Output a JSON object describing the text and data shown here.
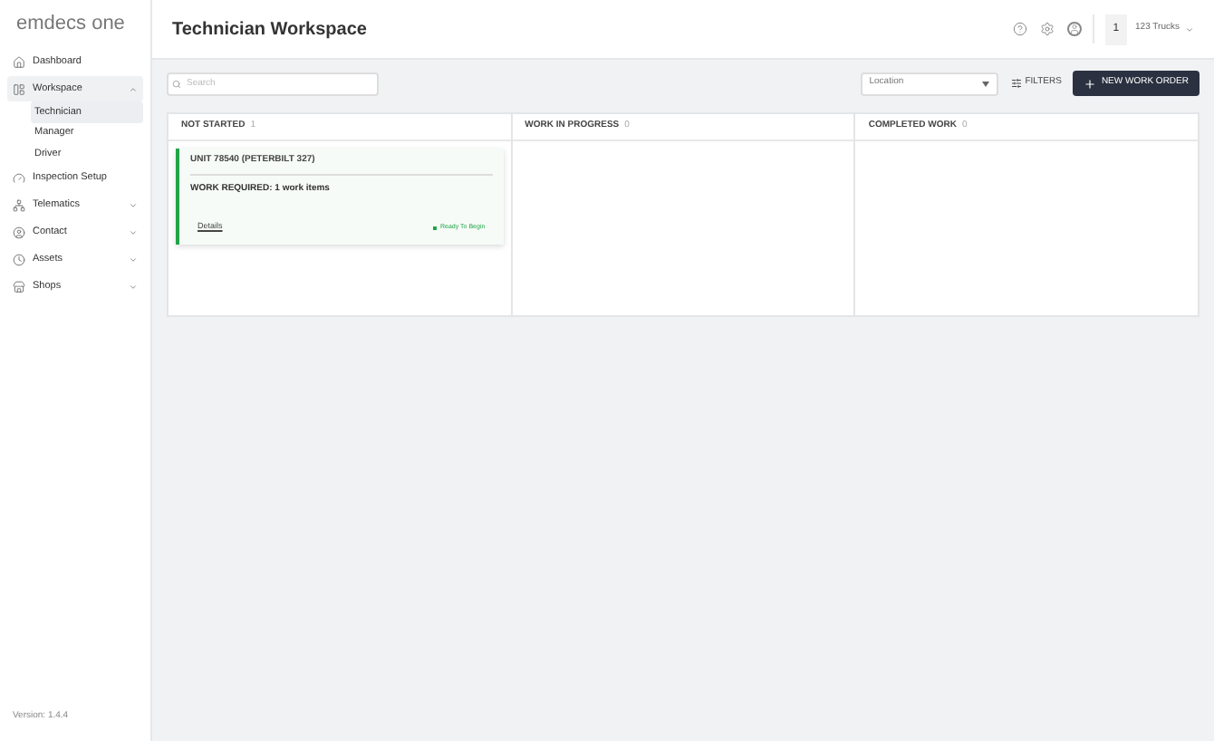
{
  "logo": "emdecs one",
  "sidebar": {
    "items": [
      {
        "label": "Dashboard",
        "kind": "link",
        "selected": false
      },
      {
        "label": "Workspace",
        "kind": "group",
        "expanded": true,
        "selected": true,
        "children": [
          {
            "label": "Technician",
            "selected": true
          },
          {
            "label": "Manager",
            "selected": false
          },
          {
            "label": "Driver",
            "selected": false
          }
        ]
      },
      {
        "label": "Inspection Setup",
        "kind": "link",
        "selected": false
      },
      {
        "label": "Telematics",
        "kind": "group",
        "expanded": false,
        "selected": false
      },
      {
        "label": "Contact",
        "kind": "group",
        "expanded": false,
        "selected": false
      },
      {
        "label": "Assets",
        "kind": "group",
        "expanded": false,
        "selected": false
      },
      {
        "label": "Shops",
        "kind": "group",
        "expanded": false,
        "selected": false
      }
    ],
    "version": "Version: 1.4.4"
  },
  "header": {
    "title": "Technician Workspace",
    "count": "1",
    "trucks": "123 Trucks"
  },
  "toolbar": {
    "search": {
      "placeholder": "Search"
    },
    "location": {
      "placeholder": "Location"
    },
    "filters": "FILTERS",
    "new_button": "NEW WORK ORDER"
  },
  "columns": [
    {
      "title": "NOT STARTED",
      "count": "1",
      "cards": [
        {
          "unit": "UNIT 78540 (PETERBILT 327)",
          "work": "WORK REQUIRED: 1 work items",
          "link": "Details",
          "status": "Ready To Begin",
          "color": "#22a447"
        }
      ]
    },
    {
      "title": "WORK IN PROGRESS",
      "count": "0"
    },
    {
      "title": "COMPLETED WORK",
      "count": "0"
    }
  ]
}
